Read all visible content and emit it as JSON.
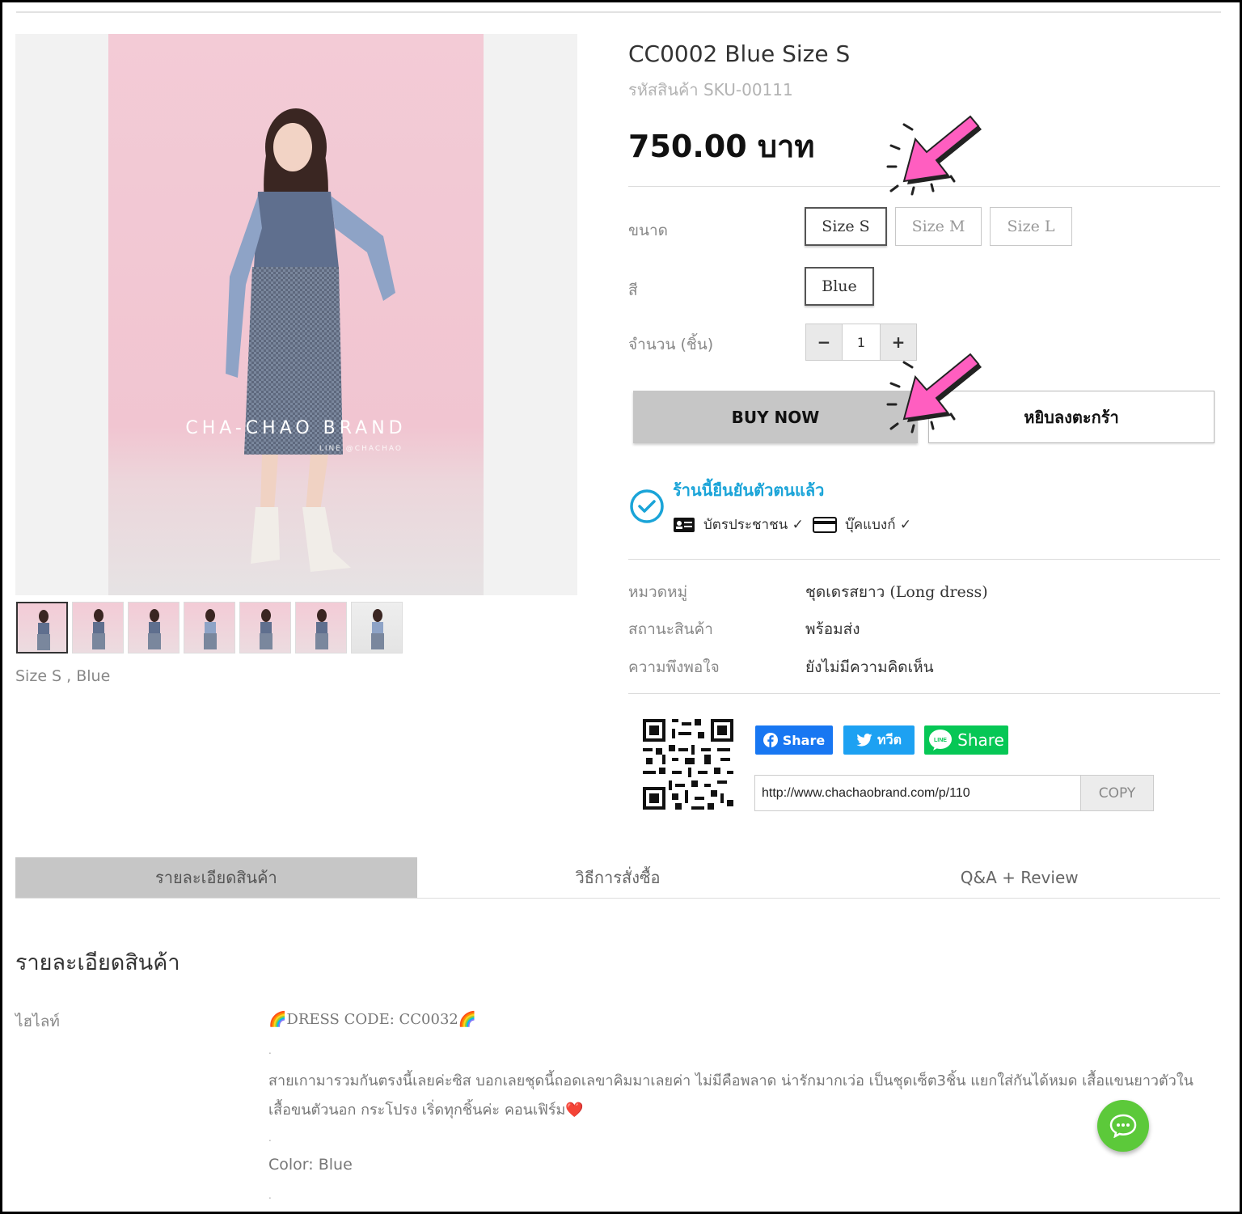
{
  "product": {
    "title": "CC0002 Blue Size S",
    "sku": "รหัสสินค้า SKU-00111",
    "price": "750.00 บาท",
    "variant_caption": "Size S , Blue",
    "image_brand": "CHA-CHAO BRAND",
    "image_sub": "LINE @CHACHAO"
  },
  "options": {
    "size_label": "ขนาด",
    "sizes": [
      "Size S",
      "Size M",
      "Size L"
    ],
    "selected_size": "Size S",
    "color_label": "สี",
    "colors": [
      "Blue"
    ],
    "qty_label": "จำนวน (ชิ้น)",
    "qty_minus": "−",
    "qty_value": "1",
    "qty_plus": "+"
  },
  "actions": {
    "buy_now": "BUY NOW",
    "add_to_cart": "หยิบลงตะกร้า"
  },
  "verification": {
    "title": "ร้านนี้ยืนยันตัวตนแล้ว",
    "id_card": "บัตรประชาชน ✓",
    "bank_book": "บุ๊คแบงก์ ✓",
    "color": "#1aa4d8"
  },
  "info": [
    {
      "label": "หมวดหมู่",
      "value": "ชุดเดรสยาว (Long dress)"
    },
    {
      "label": "สถานะสินค้า",
      "value": "พร้อมส่ง"
    },
    {
      "label": "ความพึงพอใจ",
      "value": "ยังไม่มีความคิดเห็น"
    }
  ],
  "share": {
    "facebook": "Share",
    "twitter": "ทวีต",
    "line": "Share",
    "line_logo": "LINE",
    "url": "http://www.chachaobrand.com/p/110",
    "copy": "COPY",
    "facebook_color": "#1877f2",
    "twitter_color": "#1da1f2",
    "line_color": "#06c755"
  },
  "tabs": [
    "รายละเอียดสินค้า",
    "วิธีการสั่งซื้อ",
    "Q&A + Review"
  ],
  "details": {
    "title": "รายละเอียดสินค้า",
    "highlight_label": "ไฮไลท์",
    "dress_code": "🌈DRESS CODE: CC0032🌈",
    "dot": ".",
    "line1": "สายเกามารวมกันตรงนี้เลยค่ะซิส บอกเลยชุดนี้ถอดเลขาคิมมาเลยค่า ไม่มีคือพลาด น่ารักมากเว่อ เป็นชุดเซ็ต3ชิ้น แยกใส่กันได้หมด เสื้อแขนยาวตัวใน",
    "line2": "เสื้อขนตัวนอก กระโปรง เริ่ดทุกชิ้นค่ะ คอนเฟิร์ม❤️",
    "color_line": "Color: Blue"
  },
  "colors": {
    "accent_pink": "#ff5ec0",
    "gray_button": "#c6c6c6",
    "chat_green": "#5cc93a"
  },
  "icons": [
    "check-circle-icon",
    "id-card-icon",
    "credit-card-icon",
    "qr-code-icon",
    "facebook-icon",
    "twitter-icon",
    "line-icon",
    "chat-icon",
    "pink-arrow-icon"
  ]
}
